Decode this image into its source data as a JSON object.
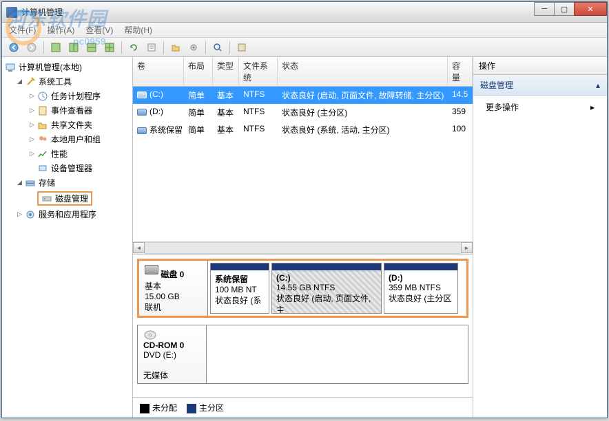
{
  "window": {
    "title": "计算机管理"
  },
  "watermark": {
    "text": "河东软件园",
    "sub": "pc0959"
  },
  "menu": {
    "file": "文件(F)",
    "action": "操作(A)",
    "view": "查看(V)",
    "help": "帮助(H)"
  },
  "tree": {
    "root": "计算机管理(本地)",
    "sys_tools": "系统工具",
    "task_sched": "任务计划程序",
    "event_viewer": "事件查看器",
    "shared": "共享文件夹",
    "local_users": "本地用户和组",
    "perf": "性能",
    "devmgr": "设备管理器",
    "storage": "存储",
    "diskmgmt": "磁盘管理",
    "services": "服务和应用程序"
  },
  "vol_headers": {
    "vol": "卷",
    "layout": "布局",
    "type": "类型",
    "fs": "文件系统",
    "status": "状态",
    "cap": "容量"
  },
  "volumes": [
    {
      "name": "(C:)",
      "layout": "简单",
      "type": "基本",
      "fs": "NTFS",
      "status": "状态良好 (启动, 页面文件, 故障转储, 主分区)",
      "cap": "14.5"
    },
    {
      "name": "(D:)",
      "layout": "简单",
      "type": "基本",
      "fs": "NTFS",
      "status": "状态良好 (主分区)",
      "cap": "359"
    },
    {
      "name": "系统保留",
      "layout": "简单",
      "type": "基本",
      "fs": "NTFS",
      "status": "状态良好 (系统, 活动, 主分区)",
      "cap": "100"
    }
  ],
  "disk0": {
    "title": "磁盘 0",
    "type": "基本",
    "size": "15.00 GB",
    "status": "联机",
    "p1_name": "系统保留",
    "p1_size": "100 MB NT",
    "p1_status": "状态良好 (系",
    "p2_name": "(C:)",
    "p2_size": "14.55 GB NTFS",
    "p2_status": "状态良好 (启动, 页面文件, 主",
    "p3_name": "(D:)",
    "p3_size": "359 MB NTFS",
    "p3_status": "状态良好 (主分区"
  },
  "cdrom": {
    "title": "CD-ROM 0",
    "drive": "DVD (E:)",
    "status": "无媒体"
  },
  "legend": {
    "unalloc": "未分配",
    "primary": "主分区"
  },
  "actions": {
    "header": "操作",
    "diskmgmt": "磁盘管理",
    "more": "更多操作"
  }
}
